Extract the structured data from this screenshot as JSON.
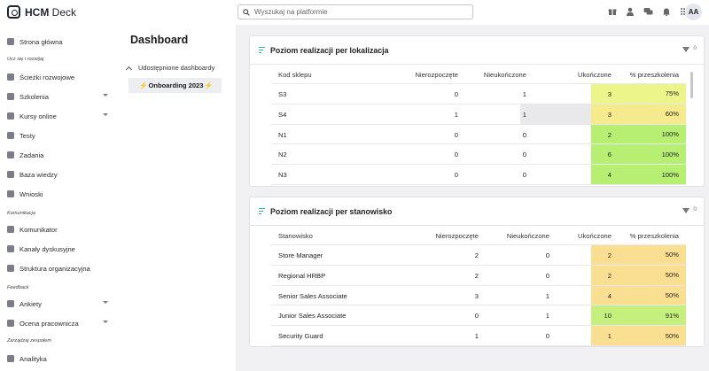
{
  "header": {
    "logo_text_bold": "HCM",
    "logo_text_light": " Deck",
    "search_placeholder": "Wyszukaj na platformie",
    "icons": [
      "gift-icon",
      "user-icon",
      "chat-icon",
      "bell-icon",
      "grid-icon"
    ],
    "avatar_initials": "AA"
  },
  "sidebar": {
    "items": [
      {
        "label": "Strona główna",
        "icon": "home-icon"
      },
      {
        "section": "Ucz się i rozwijaj"
      },
      {
        "label": "Ścieżki rozwojowe",
        "icon": "path-icon"
      },
      {
        "label": "Szkolenia",
        "icon": "training-icon",
        "chevron": true
      },
      {
        "label": "Kursy online",
        "icon": "course-icon",
        "chevron": true
      },
      {
        "label": "Testy",
        "icon": "test-icon"
      },
      {
        "label": "Zadania",
        "icon": "task-icon"
      },
      {
        "label": "Baza wiedzy",
        "icon": "knowledge-icon"
      },
      {
        "label": "Wnioski",
        "icon": "request-icon"
      },
      {
        "section": "Komunikacja"
      },
      {
        "label": "Komunikator",
        "icon": "messenger-icon"
      },
      {
        "label": "Kanały dyskusyjne",
        "icon": "channels-icon"
      },
      {
        "label": "Struktura organizacyjna",
        "icon": "org-icon"
      },
      {
        "section": "Feedback"
      },
      {
        "label": "Ankiety",
        "icon": "survey-icon",
        "chevron": true
      },
      {
        "label": "Ocena pracownicza",
        "icon": "review-icon",
        "chevron": true
      },
      {
        "section": "Zarządzaj zespołem"
      },
      {
        "label": "Analityka",
        "icon": "analytics-icon"
      }
    ]
  },
  "dashboard_panel": {
    "title": "Dashboard",
    "shared_label": "Udostępnione dashboardy",
    "active_item": "Onboarding 2023",
    "bolt": "⚡"
  },
  "cards": [
    {
      "title": "Poziom realizacji per lokalizacja",
      "filter_count": "0",
      "columns": [
        "Kod sklepu",
        "Nierozpoczęte",
        "Nieukończone",
        "Ukończone",
        "% przeszkolenia"
      ],
      "rows": [
        {
          "name": "S3",
          "not_started": "0",
          "unfinished": "1",
          "done": "3",
          "pct": "75%",
          "color": "#ecf58a"
        },
        {
          "name": "S4",
          "not_started": "1",
          "unfinished": "1",
          "done": "3",
          "pct": "60%",
          "color": "#f6ea8e",
          "highlight": true
        },
        {
          "name": "N1",
          "not_started": "0",
          "unfinished": "0",
          "done": "2",
          "pct": "100%",
          "color": "#b7ef73"
        },
        {
          "name": "N2",
          "not_started": "0",
          "unfinished": "0",
          "done": "6",
          "pct": "100%",
          "color": "#b7ef73"
        },
        {
          "name": "N3",
          "not_started": "0",
          "unfinished": "0",
          "done": "4",
          "pct": "100%",
          "color": "#b7ef73"
        }
      ]
    },
    {
      "title": "Poziom realizacji per stanowisko",
      "filter_count": "0",
      "columns": [
        "Stanowisko",
        "Nierozpoczęte",
        "Nieukończone",
        "Ukończone",
        "% przeszkolenia"
      ],
      "rows": [
        {
          "name": "Store Manager",
          "not_started": "2",
          "unfinished": "0",
          "done": "2",
          "pct": "50%",
          "color": "#fadf92"
        },
        {
          "name": "Regional HRBP",
          "not_started": "2",
          "unfinished": "0",
          "done": "2",
          "pct": "50%",
          "color": "#fadf92"
        },
        {
          "name": "Senior Sales Associate",
          "not_started": "3",
          "unfinished": "1",
          "done": "4",
          "pct": "50%",
          "color": "#fadf92"
        },
        {
          "name": "Junior Sales Associate",
          "not_started": "0",
          "unfinished": "1",
          "done": "10",
          "pct": "91%",
          "color": "#c5f07d"
        },
        {
          "name": "Security Guard",
          "not_started": "1",
          "unfinished": "0",
          "done": "1",
          "pct": "50%",
          "color": "#fadf92"
        }
      ]
    }
  ]
}
